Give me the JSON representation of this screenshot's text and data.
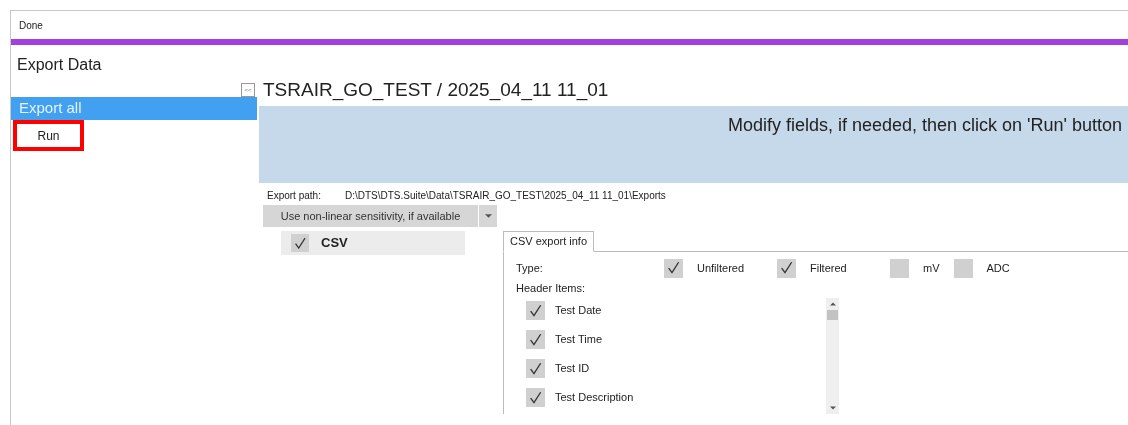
{
  "status_bar": {
    "text": "Done"
  },
  "panel_title": "Export Data",
  "sidebar": {
    "collapse_label": "<<",
    "items": [
      {
        "label": "Export all",
        "selected": true
      }
    ],
    "run_button": {
      "label": "Run",
      "highlighted": true
    }
  },
  "main": {
    "title": "TSRAIR_GO_TEST / 2025_04_11 11_01",
    "banner": "Modify fields, if needed, then click on 'Run' button",
    "export_path_label": "Export path:",
    "export_path": "D:\\DTS\\DTS.Suite\\Data\\TSRAIR_GO_TEST\\2025_04_11 11_01\\Exports",
    "sensitivity_dropdown": "Use non-linear sensitivity, if available",
    "formats": [
      {
        "label": "CSV",
        "checked": true
      }
    ],
    "tabs": [
      {
        "label": "CSV export info",
        "selected": true
      }
    ],
    "type_label": "Type:",
    "types": [
      {
        "label": "Unfiltered",
        "checked": true
      },
      {
        "label": "Filtered",
        "checked": true
      },
      {
        "label": "mV",
        "checked": false
      },
      {
        "label": "ADC",
        "checked": false
      }
    ],
    "header_items_label": "Header Items:",
    "header_items": [
      {
        "label": "Test Date",
        "checked": true
      },
      {
        "label": "Test Time",
        "checked": true
      },
      {
        "label": "Test ID",
        "checked": true
      },
      {
        "label": "Test Description",
        "checked": true
      }
    ]
  }
}
